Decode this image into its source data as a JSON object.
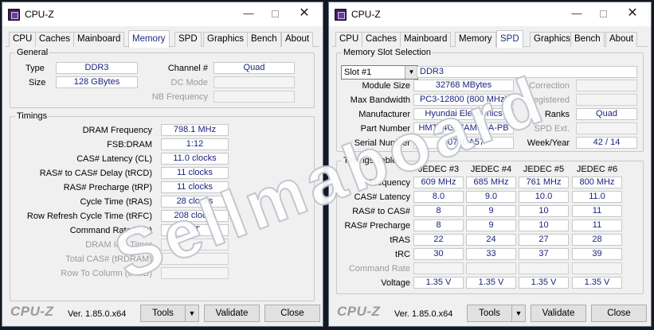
{
  "memory_window": {
    "title": "CPU-Z",
    "tabs": [
      "CPU",
      "Caches",
      "Mainboard",
      "Memory",
      "SPD",
      "Graphics",
      "Bench",
      "About"
    ],
    "active_tab": "Memory",
    "general": {
      "title": "General",
      "type_label": "Type",
      "type": "DDR3",
      "size_label": "Size",
      "size": "128 GBytes",
      "channel_label": "Channel #",
      "channel": "Quad",
      "dc_mode_label": "DC Mode",
      "dc_mode": "",
      "nb_freq_label": "NB Frequency",
      "nb_freq": ""
    },
    "timings": {
      "title": "Timings",
      "rows": [
        {
          "label": "DRAM Frequency",
          "value": "798.1 MHz",
          "enabled": true
        },
        {
          "label": "FSB:DRAM",
          "value": "1:12",
          "enabled": true
        },
        {
          "label": "CAS# Latency (CL)",
          "value": "11.0 clocks",
          "enabled": true
        },
        {
          "label": "RAS# to CAS# Delay (tRCD)",
          "value": "11 clocks",
          "enabled": true
        },
        {
          "label": "RAS# Precharge (tRP)",
          "value": "11 clocks",
          "enabled": true
        },
        {
          "label": "Cycle Time (tRAS)",
          "value": "28 clocks",
          "enabled": true
        },
        {
          "label": "Row Refresh Cycle Time (tRFC)",
          "value": "208 clocks",
          "enabled": true
        },
        {
          "label": "Command Rate (CR)",
          "value": "1T",
          "enabled": true
        },
        {
          "label": "DRAM Idle Timer",
          "value": "",
          "enabled": false
        },
        {
          "label": "Total CAS# (tRDRAM)",
          "value": "",
          "enabled": false
        },
        {
          "label": "Row To Column (tRCD)",
          "value": "",
          "enabled": false
        }
      ]
    },
    "bottom": {
      "logo": "CPU-Z",
      "version": "Ver. 1.85.0.x64",
      "tools": "Tools",
      "validate": "Validate",
      "close": "Close"
    }
  },
  "spd_window": {
    "title": "CPU-Z",
    "tabs": [
      "CPU",
      "Caches",
      "Mainboard",
      "Memory",
      "SPD",
      "Graphics",
      "Bench",
      "About"
    ],
    "active_tab": "SPD",
    "slot_group_title": "Memory Slot Selection",
    "slot": "Slot #1",
    "mem_type": "DDR3",
    "module_size_label": "Module Size",
    "module_size": "32768 MBytes",
    "max_bw_label": "Max Bandwidth",
    "max_bw": "PC3-12800 (800 MHz)",
    "manufacturer_label": "Manufacturer",
    "manufacturer": "Hyundai Electronics",
    "part_label": "Part Number",
    "part": "HMT84GL7AMR4A-PB",
    "serial_label": "Serial Number",
    "serial": "4074DA57",
    "correction_label": "Correction",
    "correction": "",
    "registered_label": "Registered",
    "registered": "",
    "ranks_label": "Ranks",
    "ranks": "Quad",
    "spd_ext_label": "SPD Ext.",
    "spd_ext": "",
    "week_year_label": "Week/Year",
    "week_year": "42 / 14",
    "timings_table": {
      "title": "Timings Table",
      "columns": [
        "JEDEC #3",
        "JEDEC #4",
        "JEDEC #5",
        "JEDEC #6"
      ],
      "rows": [
        {
          "label": "Frequency",
          "values": [
            "609 MHz",
            "685 MHz",
            "761 MHz",
            "800 MHz"
          ],
          "enabled": true
        },
        {
          "label": "CAS# Latency",
          "values": [
            "8.0",
            "9.0",
            "10.0",
            "11.0"
          ],
          "enabled": true
        },
        {
          "label": "RAS# to CAS#",
          "values": [
            "8",
            "9",
            "10",
            "11"
          ],
          "enabled": true
        },
        {
          "label": "RAS# Precharge",
          "values": [
            "8",
            "9",
            "10",
            "11"
          ],
          "enabled": true
        },
        {
          "label": "tRAS",
          "values": [
            "22",
            "24",
            "27",
            "28"
          ],
          "enabled": true
        },
        {
          "label": "tRC",
          "values": [
            "30",
            "33",
            "37",
            "39"
          ],
          "enabled": true
        },
        {
          "label": "Command Rate",
          "values": [
            "",
            "",
            "",
            ""
          ],
          "enabled": false
        },
        {
          "label": "Voltage",
          "values": [
            "1.35 V",
            "1.35 V",
            "1.35 V",
            "1.35 V"
          ],
          "enabled": true
        }
      ]
    },
    "bottom": {
      "logo": "CPU-Z",
      "version": "Ver. 1.85.0.x64",
      "tools": "Tools",
      "validate": "Validate",
      "close": "Close"
    }
  },
  "watermark": "Sellmaboard",
  "colors": {
    "value_text": "#1a237e",
    "active_tab_text": "#1a2e80",
    "background": "#141820"
  }
}
